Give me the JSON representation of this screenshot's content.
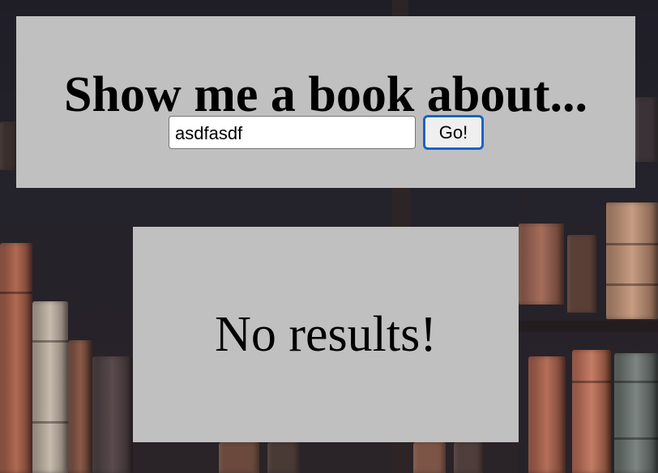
{
  "header": {
    "title": "Show me a book about..."
  },
  "search": {
    "value": "asdfasdf",
    "button_label": "Go!"
  },
  "results": {
    "message": "No results!"
  },
  "colors": {
    "panel_background": "#c0c0c0",
    "button_focus_border": "#1764c4",
    "page_background": "#1c1b25"
  },
  "icons": {
    "background": "bookshelf-background-image"
  }
}
